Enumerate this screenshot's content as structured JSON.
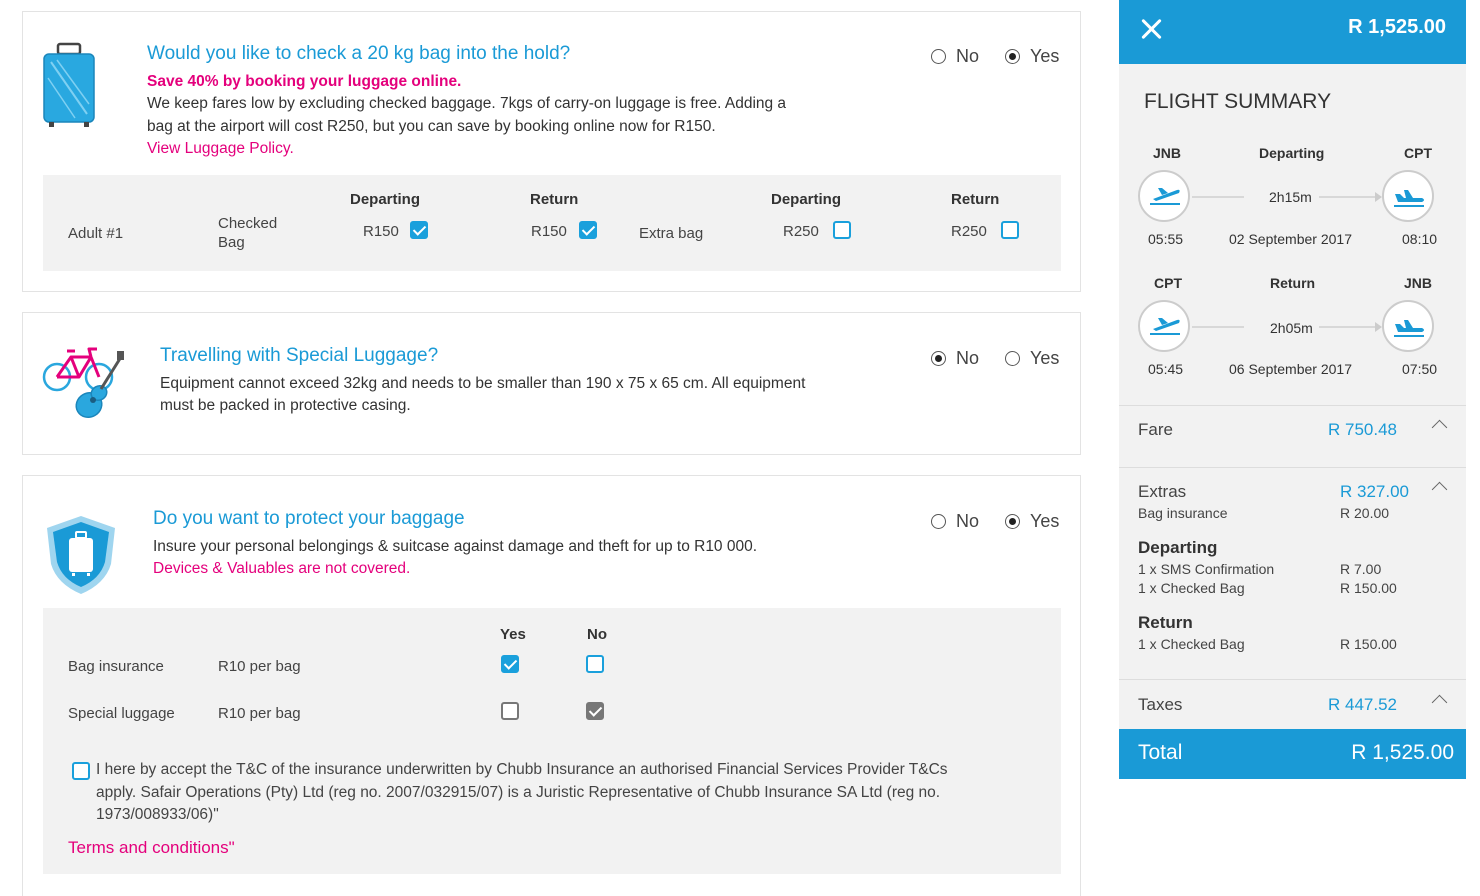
{
  "luggage": {
    "title": "Would you like to check a 20 kg bag into the hold?",
    "promo": "Save 40% by booking your luggage online.",
    "desc_line1": "We keep fares low by excluding checked baggage. 7kgs of carry-on luggage is free. Adding a",
    "desc_line2": "bag at the airport will cost R250, but you can save by booking online now for R150.",
    "policy_link": "View Luggage Policy.",
    "option_no": "No",
    "option_yes": "Yes",
    "selected": "Yes",
    "table": {
      "passenger": "Adult #1",
      "checked_label_1": "Checked",
      "checked_label_2": "Bag",
      "col_departing": "Departing",
      "col_return": "Return",
      "checked_dep_price": "R150",
      "checked_ret_price": "R150",
      "extra_label": "Extra bag",
      "extra_dep_price": "R250",
      "extra_ret_price": "R250",
      "checked_dep_selected": true,
      "checked_ret_selected": true,
      "extra_dep_selected": false,
      "extra_ret_selected": false
    }
  },
  "special": {
    "title": "Travelling with Special Luggage?",
    "desc_line1": "Equipment cannot exceed 32kg and needs to be smaller than 190 x 75 x 65 cm. All equipment",
    "desc_line2": "must be packed in protective casing.",
    "option_no": "No",
    "option_yes": "Yes",
    "selected": "No"
  },
  "protect": {
    "title": "Do you want to protect your baggage",
    "desc": "Insure your personal belongings & suitcase against damage and theft for up to R10 000.",
    "note": "Devices & Valuables are not covered.",
    "option_no": "No",
    "option_yes": "Yes",
    "selected": "Yes",
    "col_yes": "Yes",
    "col_no": "No",
    "rows": [
      {
        "label": "Bag insurance",
        "price": "R10 per bag",
        "yes": true,
        "no": false
      },
      {
        "label": "Special luggage",
        "price": "R10 per bag",
        "yes": false,
        "no": true
      }
    ],
    "tc_line1": "I here by accept the T&C of the insurance underwritten by Chubb Insurance an authorised Financial Services Provider T&Cs",
    "tc_line2": "apply. Safair Operations (Pty) Ltd (reg no. 2007/032915/07) is a Juristic Representative of Chubb Insurance SA Ltd (reg no.",
    "tc_line3": "1973/008933/06)\"",
    "terms_link": "Terms and conditions\""
  },
  "summary": {
    "header_total": "R 1,525.00",
    "title": "FLIGHT SUMMARY",
    "departing": {
      "from": "JNB",
      "label": "Departing",
      "to": "CPT",
      "duration": "2h15m",
      "dep_time": "05:55",
      "date": "02 September 2017",
      "arr_time": "08:10"
    },
    "return": {
      "from": "CPT",
      "label": "Return",
      "to": "JNB",
      "duration": "2h05m",
      "dep_time": "05:45",
      "date": "06 September 2017",
      "arr_time": "07:50"
    },
    "fare_label": "Fare",
    "fare_value": "R 750.48",
    "extras_label": "Extras",
    "extras_value": "R 327.00",
    "bag_insurance_label": "Bag insurance",
    "bag_insurance_value": "R 20.00",
    "dep_head": "Departing",
    "dep_items": [
      {
        "label": "1 x SMS Confirmation",
        "value": "R 7.00"
      },
      {
        "label": "1 x Checked Bag",
        "value": "R 150.00"
      }
    ],
    "ret_head": "Return",
    "ret_items": [
      {
        "label": "1 x Checked Bag",
        "value": "R 150.00"
      }
    ],
    "taxes_label": "Taxes",
    "taxes_value": "R 447.52",
    "total_label": "Total",
    "total_value": "R 1,525.00",
    "accent": "#1a9ad6",
    "promo_color": "#e4007c"
  }
}
